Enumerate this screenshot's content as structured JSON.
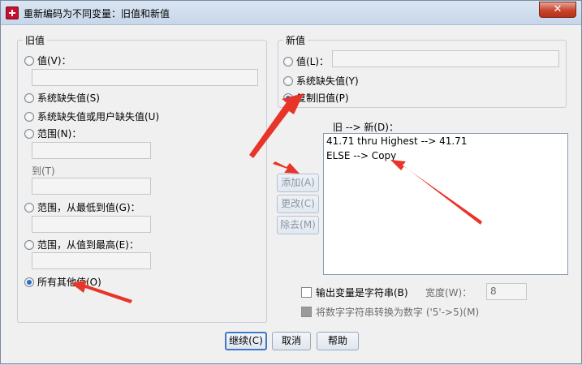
{
  "window": {
    "title": "重新编码为不同变量：旧值和新值",
    "close_glyph": "✕"
  },
  "old_value": {
    "legend": "旧值",
    "value_label": "值(V)：",
    "system_missing_label": "系统缺失值(S)",
    "system_or_user_missing_label": "系统缺失值或用户缺失值(U)",
    "range_label": "范围(N)：",
    "to_label": "到(T)",
    "range_lowest_label": "范围，从最低到值(G)：",
    "range_highest_label": "范围，从值到最高(E)：",
    "all_other_label": "所有其他值(O)"
  },
  "new_value": {
    "legend": "新值",
    "value_label": "值(L)：",
    "system_missing_label": "系统缺失值(Y)",
    "copy_old_label": "复制旧值(P)"
  },
  "mapping": {
    "label": "旧 --> 新(D)：",
    "items": [
      "41.71 thru Highest --> 41.71",
      "ELSE --> Copy"
    ]
  },
  "actions": {
    "add": "添加(A)",
    "change": "更改(C)",
    "remove": "除去(M)"
  },
  "output": {
    "string_label": "输出变量是字符串(B)",
    "width_label": "宽度(W)：",
    "width_value": "8",
    "convert_label": "将数字字符串转换为数字 ('5'->5)(M)"
  },
  "footer": {
    "continue": "继续(C)",
    "cancel": "取消",
    "help": "帮助"
  },
  "colors": {
    "annotation_arrow": "#e8352a",
    "accent": "#2a6ccb"
  }
}
